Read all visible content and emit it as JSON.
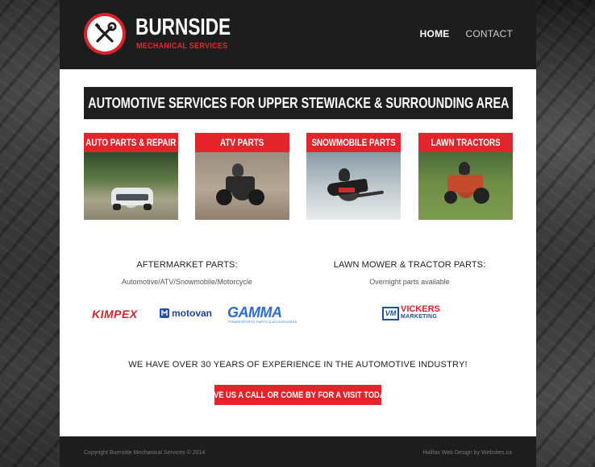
{
  "brand": {
    "title": "BURNSIDE",
    "subtitle": "MECHANICAL SERVICES",
    "logo_icon": "wrench-screwdriver-icon",
    "accent_color": "#e3242b"
  },
  "nav": {
    "items": [
      {
        "label": "HOME",
        "active": true
      },
      {
        "label": "CONTACT",
        "active": false
      }
    ]
  },
  "banner": {
    "text": "AUTOMOTIVE SERVICES FOR UPPER STEWIACKE & SURROUNDING AREA"
  },
  "services": [
    {
      "title": "AUTO PARTS & REPAIR",
      "image": "suv-on-forest-road"
    },
    {
      "title": "ATV PARTS",
      "image": "rider-on-atv"
    },
    {
      "title": "SNOWMOBILE PARTS",
      "image": "rider-on-snowmobile"
    },
    {
      "title": "LAWN TRACTORS",
      "image": "man-on-red-lawn-tractor"
    }
  ],
  "aftermarket": {
    "heading": "AFTERMARKET PARTS:",
    "sub": "Automotive/ATV/Snowmobile/Motorcycle",
    "brands": [
      {
        "name": "KIMPEX"
      },
      {
        "name": "motovan"
      },
      {
        "name": "GAMMA",
        "tagline": "POWERSPORTS PARTS & ACCESSORIES"
      }
    ]
  },
  "lawn": {
    "heading": "LAWN MOWER & TRACTOR PARTS:",
    "sub": "Overnight parts available",
    "brands": [
      {
        "name": "VICKERS",
        "tagline": "MARKETING",
        "mark": "VM"
      }
    ]
  },
  "experience": "WE HAVE OVER 30 YEARS OF EXPERIENCE IN THE AUTOMOTIVE INDUSTRY!",
  "cta": {
    "label": "GIVE US A CALL OR COME BY FOR A VISIT TODAY"
  },
  "footer": {
    "copyright": "Copyright Burnside Mechanical Services © 2014",
    "credit": "Halifax Web Design by Websites.ca"
  }
}
